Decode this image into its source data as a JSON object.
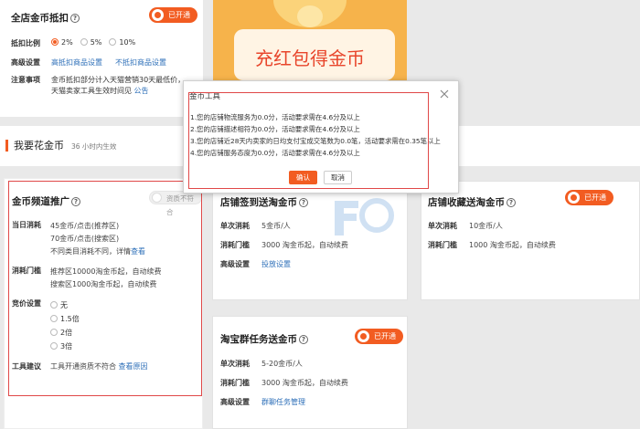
{
  "top_left": {
    "title": "全店金币抵扣",
    "status": "已开通",
    "rows": [
      {
        "label": "抵扣比例",
        "options": [
          "2%",
          "5%",
          "10%"
        ],
        "selected": "2%"
      },
      {
        "label": "高级设置",
        "links": [
          "高抵扣商品设置",
          "不抵扣商品设置"
        ]
      },
      {
        "label": "注意事项",
        "line1": "金币抵扣部分计入天猫营销30天最低价，",
        "line2": "天猫卖家工具生效时间见",
        "link": "公告"
      }
    ]
  },
  "banner": {
    "text": "充红包得金币"
  },
  "spend_section": {
    "title": "我要花金币",
    "subtitle": "36 小时内生效"
  },
  "channel_card": {
    "title": "金币频道推广",
    "status": "资质不符合",
    "daily_label": "当日消耗",
    "daily_lines": [
      "45金币/点击(推荐区)",
      "70金币/点击(搜索区)",
      "不同类目消耗不同，详情"
    ],
    "daily_link": "查看",
    "threshold_label": "消耗门槛",
    "threshold_lines": [
      "推荐区10000淘金币起，自动续费",
      "搜索区1000淘金币起，自动续费"
    ],
    "bid_label": "竞价设置",
    "bid_options": [
      "无",
      "1.5倍",
      "2倍",
      "3倍"
    ],
    "tool_label": "工具建议",
    "tool_text": "工具开通资质不符合",
    "tool_link": "查看原因"
  },
  "signin_card": {
    "title": "店铺签到送淘金币",
    "rows": [
      {
        "label": "单次消耗",
        "value": "5金币/人"
      },
      {
        "label": "消耗门槛",
        "value": "3000 淘金币起，自动续费"
      },
      {
        "label": "高级设置",
        "link": "投放设置"
      }
    ]
  },
  "collect_card": {
    "title": "店铺收藏送淘金币",
    "status": "已开通",
    "rows": [
      {
        "label": "单次消耗",
        "value": "10金币/人"
      },
      {
        "label": "消耗门槛",
        "value": "1000 淘金币起，自动续费"
      }
    ]
  },
  "group_card": {
    "title": "淘宝群任务送金币",
    "status": "已开通",
    "rows": [
      {
        "label": "单次消耗",
        "value": "5-20金币/人"
      },
      {
        "label": "消耗门槛",
        "value": "3000 淘金币起，自动续费"
      },
      {
        "label": "高级设置",
        "link": "群聊任务管理"
      }
    ]
  },
  "modal": {
    "title": "金币工具",
    "lines": [
      "1.您的店铺物流服务为0.0分，活动要求需在4.6分及以上",
      "2.您的店铺描述相符为0.0分，活动要求需在4.6分及以上",
      "3.您的店铺近28天内卖家的日均支付宝成交笔数为0.0笔，活动要求需在0.35笔以上",
      "4.您的店铺服务态度为0.0分，活动要求需在4.6分及以上"
    ],
    "confirm": "确认",
    "cancel": "取消"
  },
  "colors": {
    "accent": "#f25c21",
    "link": "#2d6fb8",
    "highlight_box": "#e04848"
  }
}
